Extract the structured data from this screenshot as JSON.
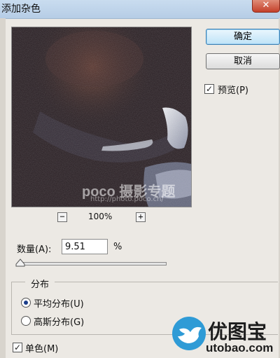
{
  "window": {
    "title": "添加杂色",
    "close_glyph": "✕"
  },
  "preview": {
    "zoom_out": "−",
    "zoom_level": "100%",
    "zoom_in": "+",
    "watermark": "poco 摄影专题",
    "watermark_url": "http://photo.poco.cn/"
  },
  "buttons": {
    "ok": "确定",
    "cancel": "取消"
  },
  "preview_toggle": {
    "label": "预览(P)",
    "checked": true
  },
  "amount": {
    "label": "数量(A):",
    "value": "9.51",
    "unit": "%"
  },
  "distribution": {
    "title": "分布",
    "options": [
      {
        "label": "平均分布(U)",
        "selected": true
      },
      {
        "label": "高斯分布(G)",
        "selected": false
      }
    ]
  },
  "monochrome": {
    "label": "单色(M)",
    "checked": true
  },
  "site_watermark": {
    "text": "优图宝",
    "url": "utobao.com"
  },
  "colors": {
    "accent": "#3c7fb1",
    "logo_blue": "#2f9bd6"
  }
}
